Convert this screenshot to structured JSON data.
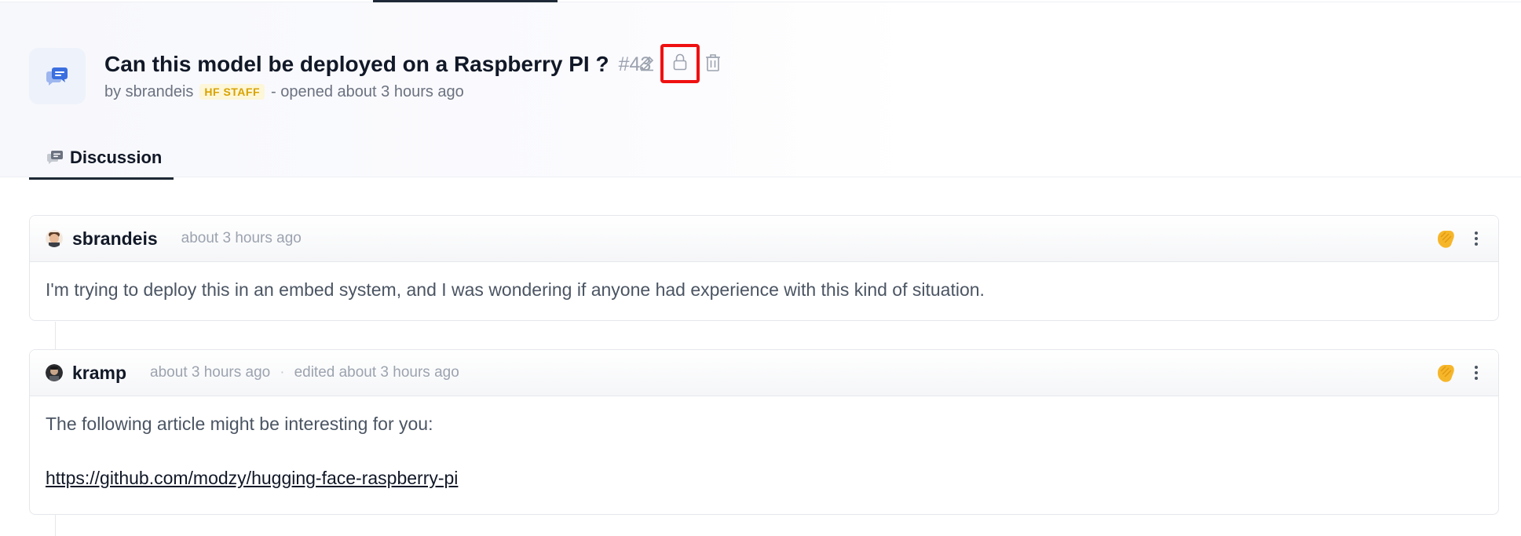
{
  "discussion": {
    "title": "Can this model be deployed on a Raspberry PI ?",
    "number": "#43",
    "byline_prefix": "by sbrandeis",
    "staff_badge": "HF STAFF",
    "opened": "- opened about 3 hours ago"
  },
  "tabs": [
    {
      "label": "Discussion",
      "icon": "discussion-icon"
    }
  ],
  "actions": [
    {
      "icon": "pencil-icon"
    },
    {
      "icon": "lock-icon",
      "highlighted": true
    },
    {
      "icon": "trash-icon"
    }
  ],
  "comments": [
    {
      "author": "sbrandeis",
      "time": "about 3 hours ago",
      "body": "I'm trying to deploy this in an embed system, and I was wondering if anyone had experience with this kind of situation.",
      "reaction_icon": "clapping-hands-icon"
    },
    {
      "author": "kramp",
      "time": "about 3 hours ago",
      "edited": "edited about 3 hours ago",
      "body": "The following article might be interesting for you:",
      "link": "https://github.com/modzy/hugging-face-raspberry-pi",
      "reaction_icon": "clapping-hands-icon"
    }
  ],
  "colors": {
    "highlight": "#ef1111",
    "staff_badge_text": "#d8a200",
    "staff_badge_bg": "#fdf6d8",
    "discussion_icon_blue": "#3b6fe0"
  }
}
